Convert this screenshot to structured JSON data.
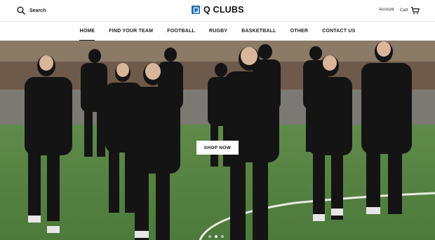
{
  "header": {
    "search_label": "Search",
    "logo_text": "Q CLUBS",
    "account_label": "Account",
    "cart_label": "Cart"
  },
  "nav": {
    "items": [
      {
        "label": "HOME",
        "active": true
      },
      {
        "label": "FIND YOUR TEAM",
        "active": false
      },
      {
        "label": "FOOTBALL",
        "active": false
      },
      {
        "label": "RUGBY",
        "active": false
      },
      {
        "label": "BASKETBALL",
        "active": false
      },
      {
        "label": "OTHER",
        "active": false
      },
      {
        "label": "CONTACT US",
        "active": false
      }
    ]
  },
  "hero": {
    "image": "football team in black training kits jogging on a grass pitch",
    "cta_label": "SHOP NOW",
    "slides": 3,
    "active_slide": 1
  },
  "icons": {
    "search": "search-icon",
    "logo": "logo-mark-icon",
    "cart": "cart-icon"
  },
  "colors": {
    "brand_blue": "#1d6fb8",
    "kit_black": "#141414",
    "text": "#1c1c1c"
  }
}
